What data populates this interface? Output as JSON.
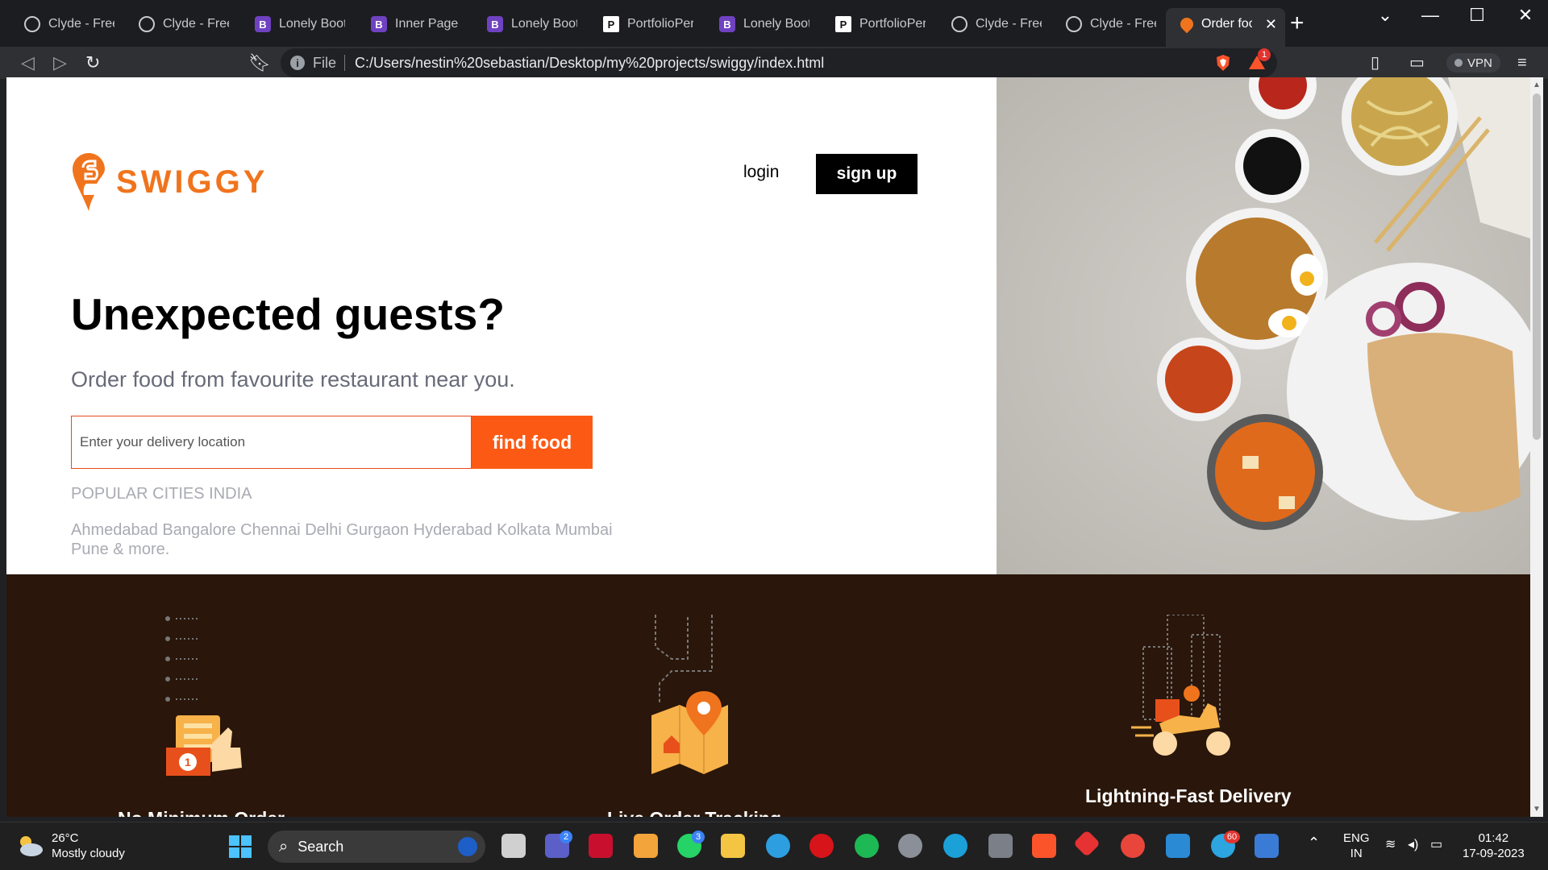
{
  "browser": {
    "tabs": [
      {
        "title": "Clyde - Free B",
        "icon": "globe"
      },
      {
        "title": "Clyde - Free B",
        "icon": "globe"
      },
      {
        "title": "Lonely Bootst",
        "icon": "bootstrap"
      },
      {
        "title": "Inner Page - L",
        "icon": "bootstrap"
      },
      {
        "title": "Lonely Bootst",
        "icon": "bootstrap"
      },
      {
        "title": "PortfolioPerfe",
        "icon": "portfolio"
      },
      {
        "title": "Lonely Bootst",
        "icon": "bootstrap"
      },
      {
        "title": "PortfolioPerfe",
        "icon": "portfolio"
      },
      {
        "title": "Clyde - Free B",
        "icon": "globe"
      },
      {
        "title": "Clyde - Free B",
        "icon": "globe"
      },
      {
        "title": "Order foo",
        "icon": "swiggy",
        "active": true
      }
    ],
    "address": {
      "scheme_label": "File",
      "url": "C:/Users/nestin%20sebastian/Desktop/my%20projects/swiggy/index.html"
    },
    "shield_count": "1",
    "vpn_label": "VPN"
  },
  "page": {
    "brand": "SWIGGY",
    "nav": {
      "login": "login",
      "signup": "sign up"
    },
    "headline": "Unexpected guests?",
    "subline": "Order food from favourite restaurant near you.",
    "search": {
      "placeholder": "Enter your delivery location",
      "button": "find food"
    },
    "popular_title": "POPULAR CITIES INDIA",
    "cities": "Ahmedabad Bangalore Chennai Delhi Gurgaon Hyderabad Kolkata Mumbai Pune & more.",
    "features": [
      {
        "title": "No Minimum Order"
      },
      {
        "title": "Live Order Tracking"
      },
      {
        "title": "Lightning-Fast Delivery"
      }
    ],
    "colors": {
      "brand": "#f0741d",
      "cta": "#fc5a14",
      "features_bg": "#2a160a"
    }
  },
  "taskbar": {
    "weather": {
      "temp": "26°C",
      "desc": "Mostly cloudy"
    },
    "search_label": "Search",
    "lang": {
      "line1": "ENG",
      "line2": "IN"
    },
    "clock": {
      "time": "01:42",
      "date": "17-09-2023"
    },
    "badges": {
      "teams": "2",
      "whatsapp": "3",
      "telegram": "60"
    }
  }
}
